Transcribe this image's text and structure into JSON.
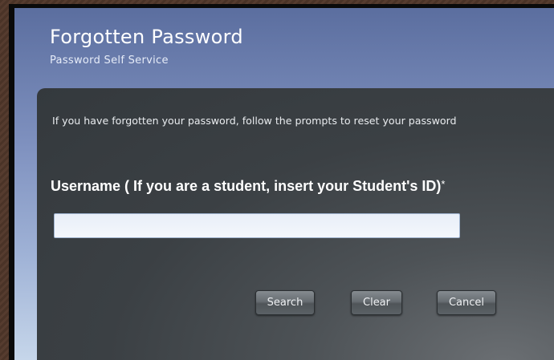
{
  "header": {
    "title": "Forgotten Password",
    "subtitle": "Password Self Service"
  },
  "form": {
    "intro_text": "If you have forgotten your password, follow the prompts to reset your password",
    "username_label": "Username ( If you are a student, insert your Student's ID)",
    "required_marker": "*",
    "username_value": ""
  },
  "buttons": {
    "search": "Search",
    "clear": "Clear",
    "cancel": "Cancel"
  }
}
